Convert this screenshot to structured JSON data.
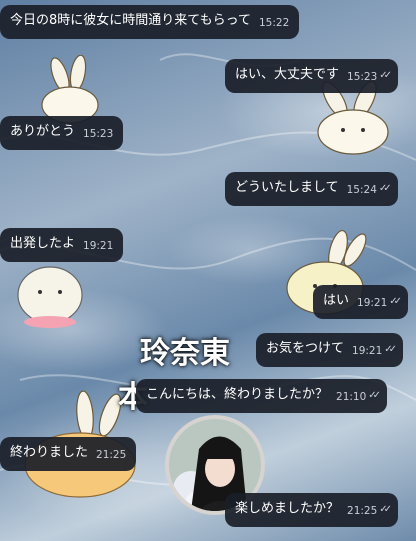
{
  "chat": {
    "messages": [
      {
        "text": "今日の8時に彼女に時間通り来てもらって",
        "time": "15:22",
        "side": "left"
      },
      {
        "text": "はい、大丈夫です",
        "time": "15:23",
        "side": "right"
      },
      {
        "text": "ありがとう",
        "time": "15:23",
        "side": "left"
      },
      {
        "text": "どういたしまして",
        "time": "15:24",
        "side": "right"
      },
      {
        "text": "出発したよ",
        "time": "19:21",
        "side": "left"
      },
      {
        "text": "はい",
        "time": "19:21",
        "side": "right"
      },
      {
        "text": "お気をつけて",
        "time": "19:21",
        "side": "right"
      },
      {
        "text": "こんにちは、終わりましたか？",
        "time": "21:10",
        "side": "right"
      },
      {
        "text": "終わりました",
        "time": "21:25",
        "side": "left"
      },
      {
        "text": "楽しめましたか？",
        "time": "21:25",
        "side": "right"
      }
    ],
    "read_mark": "✓✓"
  },
  "background": {
    "overlay_line1": "玲奈東",
    "overlay_line2": "本"
  },
  "colors": {
    "bubble_bg": "#1a1e28",
    "text": "#ffffff",
    "time": "#c9cdd6"
  },
  "icons": [
    "bunny-sticker",
    "chick-sticker",
    "avatar-photo",
    "double-check-icon"
  ]
}
